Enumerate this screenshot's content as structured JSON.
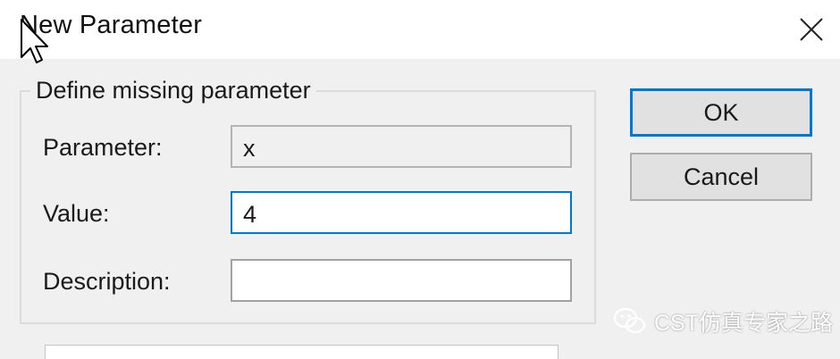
{
  "window": {
    "title": "New Parameter"
  },
  "group": {
    "legend": "Define missing parameter"
  },
  "fields": {
    "parameter": {
      "label": "Parameter:",
      "value": "x"
    },
    "value": {
      "label": "Value:",
      "value": "4"
    },
    "description": {
      "label": "Description:",
      "value": ""
    }
  },
  "buttons": {
    "ok": "OK",
    "cancel": "Cancel"
  },
  "watermark": {
    "text": "CST仿真专家之路",
    "icon": "wechat-icon"
  },
  "colors": {
    "focus": "#0078d7",
    "dialog_bg": "#f0f0f0",
    "titlebar_bg": "#ffffff"
  }
}
